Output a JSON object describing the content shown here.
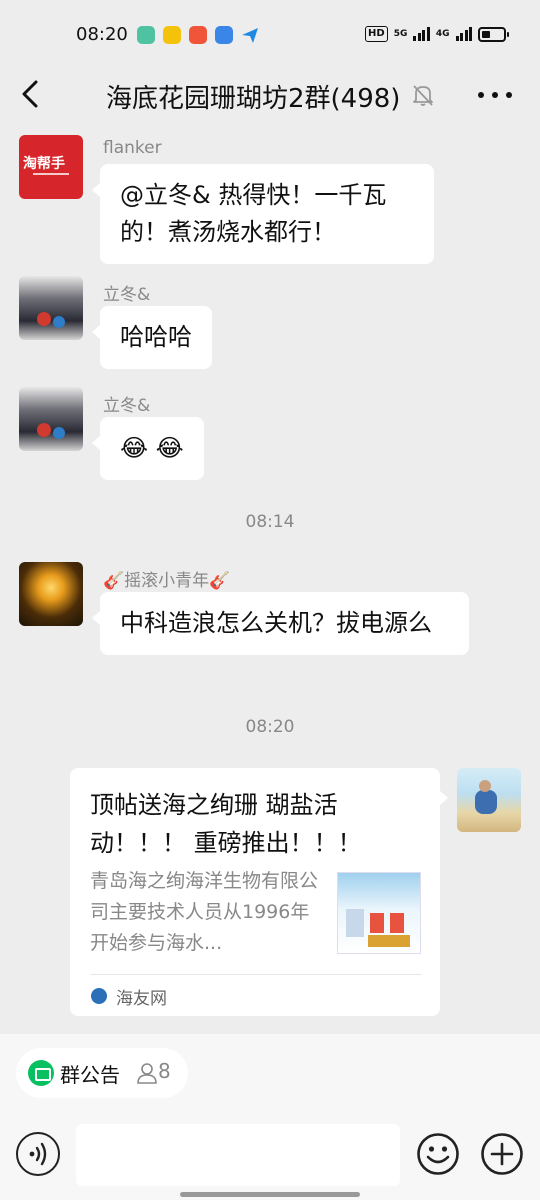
{
  "status_bar": {
    "time": "08:20",
    "hd_label": "HD",
    "network_5g": "5G",
    "network_4g": "4G"
  },
  "header": {
    "title": "海底花园珊瑚坊2群(498)",
    "back_icon": "chevron-left-icon",
    "mute_icon": "bell-off-icon",
    "more_icon": "more-horizontal-icon"
  },
  "messages": [
    {
      "sender": "flanker",
      "avatar_text": "淘帮手",
      "text": "@立冬& 热得快！一千瓦的！煮汤烧水都行！"
    },
    {
      "sender": "立冬&",
      "text": "哈哈哈"
    },
    {
      "sender": "立冬&",
      "text": "😂 😂"
    },
    {
      "sender": "🎸摇滚小青年🎸",
      "text": "中科造浪怎么关机？拔电源么"
    }
  ],
  "timestamps": [
    "08:14",
    "08:20"
  ],
  "link_card": {
    "title": "顶帖送海之绚珊 瑚盐活动！！！ 重磅推出！！！",
    "description": "青岛海之绚海洋生物有限公司主要技术人员从1996年开始参与海水...",
    "source": "海友网"
  },
  "bottom": {
    "notice_label": "群公告",
    "member_count": "8",
    "input_value": ""
  },
  "colors": {
    "accent_green": "#07c160",
    "background": "#ededed",
    "bubble": "#ffffff"
  }
}
